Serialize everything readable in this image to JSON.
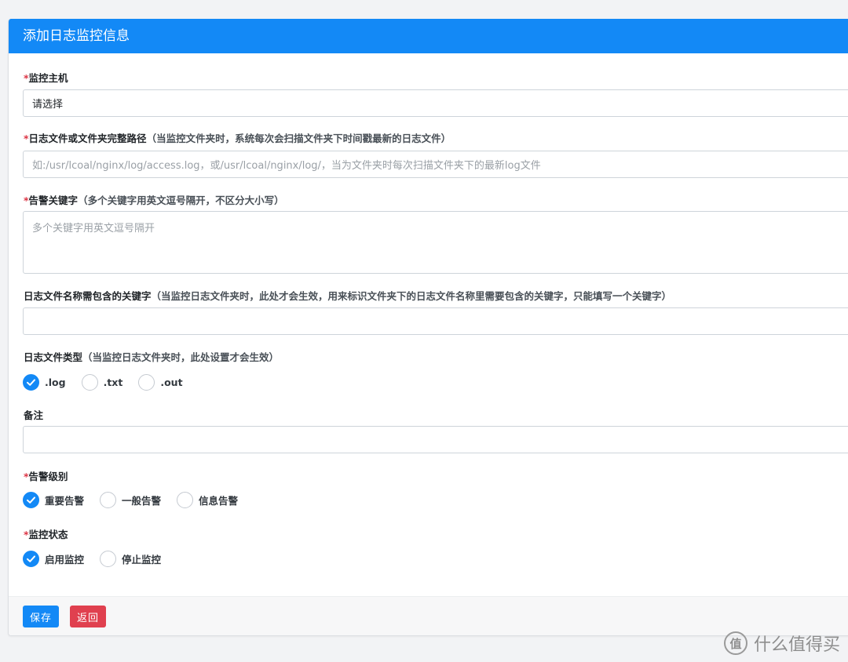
{
  "header": {
    "title": "添加日志监控信息"
  },
  "form": {
    "host": {
      "required_mark": "*",
      "label": "监控主机",
      "value": "请选择"
    },
    "path": {
      "required_mark": "*",
      "label": "日志文件或文件夹完整路径",
      "hint": "（当监控文件夹时，系统每次会扫描文件夹下时间戳最新的日志文件）",
      "placeholder": "如:/usr/lcoal/nginx/log/access.log，或/usr/lcoal/nginx/log/，当为文件夹时每次扫描文件夹下的最新log文件"
    },
    "keywords": {
      "required_mark": "*",
      "label": "告警关键字",
      "hint": "（多个关键字用英文逗号隔开，不区分大小写）",
      "placeholder": "多个关键字用英文逗号隔开"
    },
    "filename_keyword": {
      "label": "日志文件名称需包含的关键字",
      "hint": "（当监控日志文件夹时，此处才会生效，用来标识文件夹下的日志文件名称里需要包含的关键字，只能填写一个关键字）",
      "value": ""
    },
    "file_type": {
      "label": "日志文件类型",
      "hint": "（当监控日志文件夹时，此处设置才会生效）",
      "options": [
        {
          "label": ".log",
          "checked": true
        },
        {
          "label": ".txt",
          "checked": false
        },
        {
          "label": ".out",
          "checked": false
        }
      ]
    },
    "remark": {
      "label": "备注",
      "value": ""
    },
    "alert_level": {
      "required_mark": "*",
      "label": "告警级别",
      "options": [
        {
          "label": "重要告警",
          "checked": true
        },
        {
          "label": "一般告警",
          "checked": false
        },
        {
          "label": "信息告警",
          "checked": false
        }
      ]
    },
    "monitor_status": {
      "required_mark": "*",
      "label": "监控状态",
      "options": [
        {
          "label": "启用监控",
          "checked": true
        },
        {
          "label": "停止监控",
          "checked": false
        }
      ]
    }
  },
  "footer": {
    "save_label": "保存",
    "back_label": "返回"
  },
  "watermark": {
    "logo_text": "值",
    "text": "什么值得买"
  },
  "colors": {
    "primary": "#1389f6",
    "danger": "#e0404f",
    "required": "#dc3545"
  }
}
